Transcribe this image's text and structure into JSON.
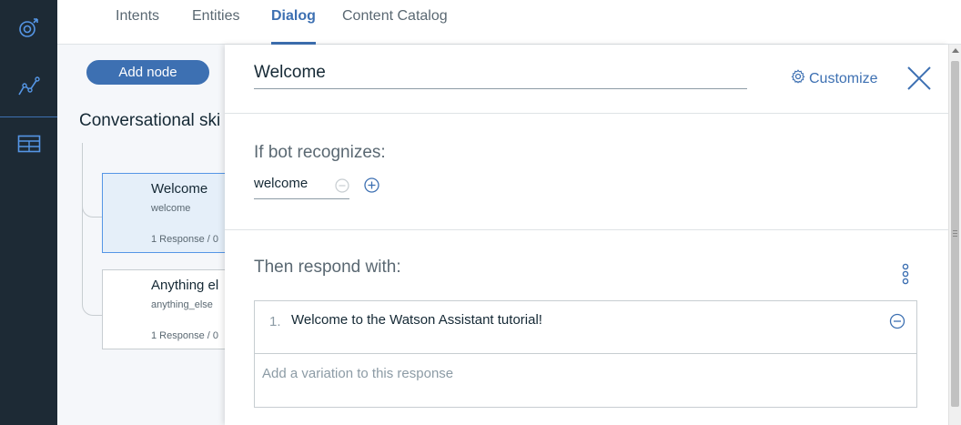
{
  "tabs": [
    {
      "label": "Intents"
    },
    {
      "label": "Entities"
    },
    {
      "label": "Dialog"
    },
    {
      "label": "Content Catalog"
    }
  ],
  "canvas": {
    "add_node_label": "Add node",
    "skill_title": "Conversational ski"
  },
  "nodes": [
    {
      "title": "Welcome",
      "condition": "welcome",
      "meta": "1 Response / 0"
    },
    {
      "title": "Anything el",
      "condition": "anything_else",
      "meta": "1 Response / 0"
    }
  ],
  "editor": {
    "node_name": "Welcome",
    "customize_label": "Customize",
    "if_label": "If bot recognizes:",
    "condition_value": "welcome",
    "respond_label": "Then respond with:",
    "responses": [
      {
        "number": "1.",
        "text": "Welcome to the Watson Assistant tutorial!"
      }
    ],
    "variation_placeholder": "Add a variation to this response"
  },
  "colors": {
    "accent": "#3d70b2",
    "rail": "#1d2a35",
    "selected_node_bg": "#e5eff9"
  },
  "icons": {
    "rail": [
      "assistant-icon",
      "analytics-icon",
      "catalog-icon"
    ],
    "customize": "gear-icon",
    "close": "close-icon"
  }
}
